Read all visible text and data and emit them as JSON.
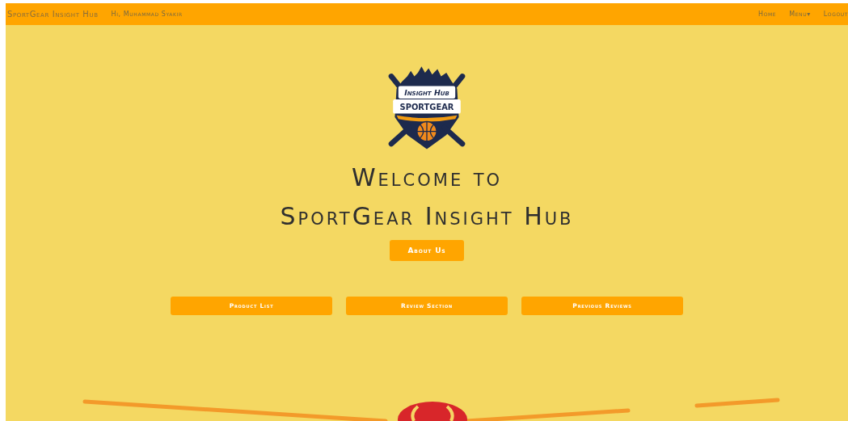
{
  "navbar": {
    "brand": "SportGear Insight Hub",
    "greeting": "Hi, Muhammad Syakir",
    "links": [
      "Home",
      "Menu",
      "Logout"
    ],
    "menu_caret": "▾"
  },
  "logo": {
    "top_text": "Insight Hub",
    "main_text": "SPORTGEAR"
  },
  "hero": {
    "title_line_1": "Welcome to",
    "title_line_2": "SportGear Insight Hub",
    "about_button": "About Us"
  },
  "actions": [
    "Product List",
    "Review Section",
    "Previous Reviews"
  ]
}
